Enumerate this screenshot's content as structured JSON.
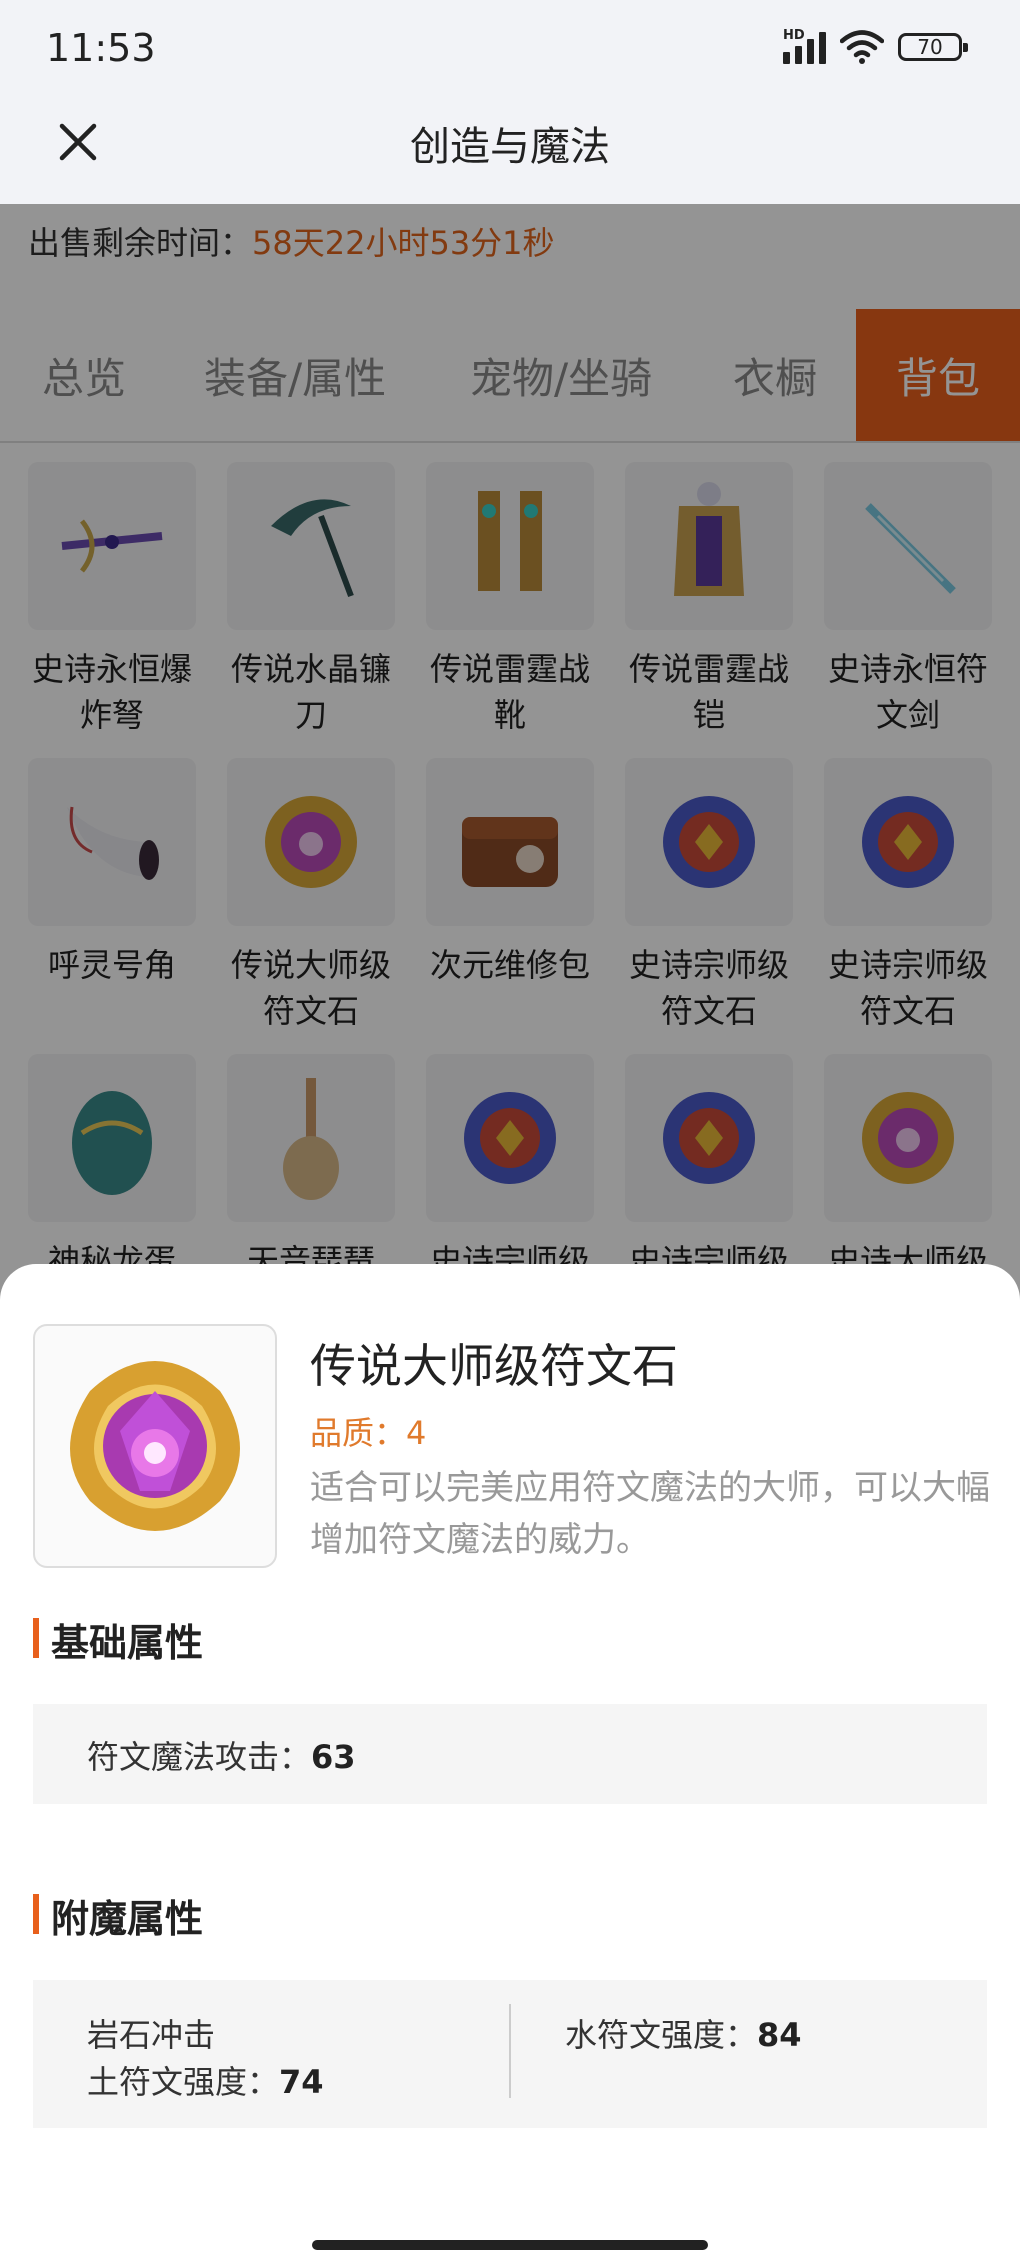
{
  "status_bar": {
    "time": "11:53",
    "hd_label": "HD",
    "battery": "70"
  },
  "header": {
    "title": "创造与魔法"
  },
  "sale": {
    "label": "出售剩余时间：",
    "time": "58天22小时53分1秒"
  },
  "tabs": [
    {
      "label": "总览"
    },
    {
      "label": "装备/属性"
    },
    {
      "label": "宠物/坐骑"
    },
    {
      "label": "衣橱"
    },
    {
      "label": "背包",
      "active": true
    }
  ],
  "grid_items": [
    {
      "name": "史诗永恒爆炸弩",
      "icon": "crossbow-icon"
    },
    {
      "name": "传说水晶镰刀",
      "icon": "scythe-icon"
    },
    {
      "name": "传说雷霆战靴",
      "icon": "boots-icon"
    },
    {
      "name": "传说雷霆战铠",
      "icon": "armor-icon"
    },
    {
      "name": "史诗永恒符文剑",
      "icon": "sword-icon"
    },
    {
      "name": "呼灵号角",
      "icon": "horn-icon"
    },
    {
      "name": "传说大师级符文石",
      "icon": "gold-rune-icon"
    },
    {
      "name": "次元维修包",
      "icon": "repair-bag-icon"
    },
    {
      "name": "史诗宗师级符文石",
      "icon": "blue-rune-icon"
    },
    {
      "name": "史诗宗师级符文石",
      "icon": "blue-rune-icon"
    },
    {
      "name": "神秘龙蛋",
      "icon": "dragon-egg-icon"
    },
    {
      "name": "天音琵琶",
      "icon": "pipa-icon"
    },
    {
      "name": "史诗宗师级",
      "icon": "blue-rune-icon"
    },
    {
      "name": "史诗宗师级",
      "icon": "blue-rune-icon"
    },
    {
      "name": "史诗大师级",
      "icon": "gold-rune-icon"
    }
  ],
  "detail": {
    "title": "传说大师级符文石",
    "quality": "品质：4",
    "description": "适合可以完美应用符文魔法的大师，可以大幅增加符文魔法的威力。",
    "basic_section": "基础属性",
    "basic_attr": {
      "label": "符文魔法攻击：",
      "value": "63"
    },
    "enchant_section": "附魔属性",
    "enchant": {
      "name": "岩石冲击",
      "earth_label": "土符文强度：",
      "earth_value": "74",
      "water_label": "水符文强度：",
      "water_value": "84"
    }
  },
  "colors": {
    "accent": "#e8601c",
    "quality": "#e07a2c"
  }
}
